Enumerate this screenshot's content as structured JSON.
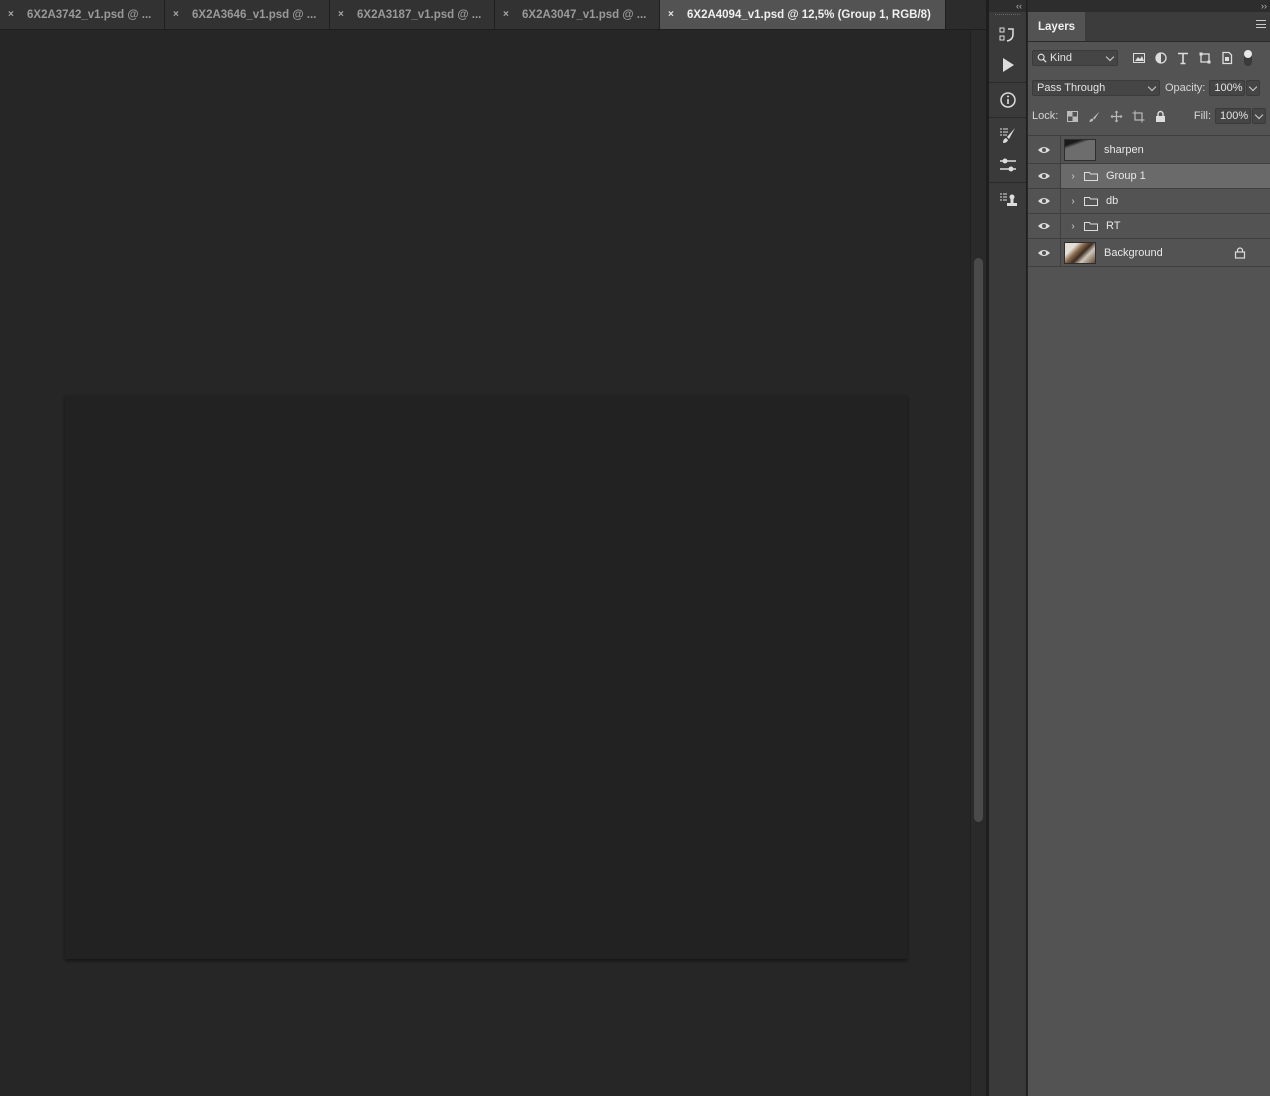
{
  "tabs": [
    {
      "label": "6X2A3742_v1.psd @ ...",
      "active": false
    },
    {
      "label": "6X2A3646_v1.psd @ ...",
      "active": false
    },
    {
      "label": "6X2A3187_v1.psd @ ...",
      "active": false
    },
    {
      "label": "6X2A3047_v1.psd @ ...",
      "active": false
    },
    {
      "label": "6X2A4094_v1.psd @ 12,5% (Group 1, RGB/8)",
      "active": true
    }
  ],
  "tab_close_glyph": "×",
  "dock": {
    "collapse_glyph": "‹‹",
    "buttons": [
      "history-icon",
      "play-action-icon",
      "info-icon",
      "brush-settings-icon",
      "adjustments-icon",
      "clone-source-icon"
    ]
  },
  "panel": {
    "expand_glyph": "››",
    "title": "Layers",
    "filter": {
      "value": "Kind",
      "icons": [
        "image-filter-icon",
        "adjustment-filter-icon",
        "type-filter-icon",
        "shape-filter-icon",
        "smart-object-filter-icon"
      ]
    },
    "blend_mode": "Pass Through",
    "opacity_label": "Opacity:",
    "opacity_value": "100%",
    "lock_label": "Lock:",
    "fill_label": "Fill:",
    "fill_value": "100%"
  },
  "layers": [
    {
      "name": "sharpen",
      "kind": "pixel",
      "thumb": "gray",
      "visible": true,
      "selected": false,
      "locked": false
    },
    {
      "name": "Group 1",
      "kind": "group",
      "visible": true,
      "selected": true,
      "locked": false
    },
    {
      "name": "db",
      "kind": "group",
      "visible": true,
      "selected": false,
      "locked": false
    },
    {
      "name": "RT",
      "kind": "group",
      "visible": true,
      "selected": false,
      "locked": false
    },
    {
      "name": "Background",
      "kind": "pixel",
      "thumb": "photo",
      "visible": true,
      "selected": false,
      "locked": true
    }
  ],
  "colors": {
    "canvas_bg": "#262626",
    "document": "#222222",
    "panel_bg": "#535353",
    "selected_row": "#6a6a6a"
  }
}
